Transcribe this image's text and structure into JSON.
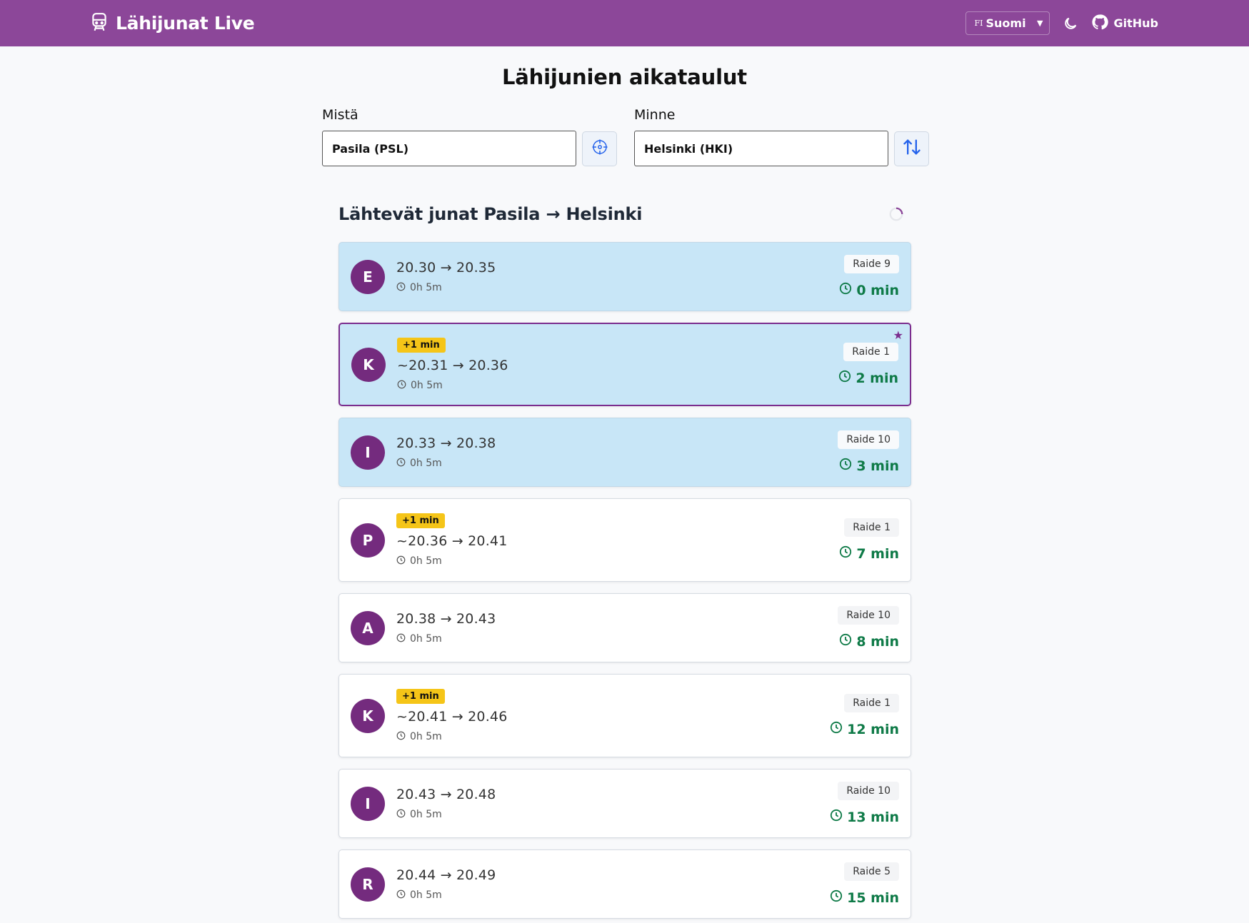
{
  "header": {
    "title": "Lähijunat Live",
    "lang_code": "FI",
    "lang_name": "Suomi",
    "github_label": "GitHub",
    "colors": {
      "bar": "#8c4799",
      "accent": "#742b7e"
    }
  },
  "page": {
    "title": "Lähijunien aikataulut"
  },
  "form": {
    "from": {
      "label": "Mistä",
      "value": "Pasila (PSL)"
    },
    "to": {
      "label": "Minne",
      "value": "Helsinki (HKI)"
    },
    "locate_icon": "crosshair-icon",
    "swap_icon": "swap-arrows-icon"
  },
  "departures": {
    "title": "Lähtevät junat Pasila → Helsinki",
    "items": [
      {
        "line": "E",
        "times": "20.30 → 20.35",
        "duration": "0h 5m",
        "track": "Raide 9",
        "eta": "0 min"
      },
      {
        "line": "K",
        "delay": "+1 min",
        "times": "~20.31 → 20.36",
        "duration": "0h 5m",
        "track": "Raide 1",
        "eta": "2 min",
        "starred": true
      },
      {
        "line": "I",
        "times": "20.33 → 20.38",
        "duration": "0h 5m",
        "track": "Raide 10",
        "eta": "3 min"
      },
      {
        "line": "P",
        "delay": "+1 min",
        "times": "~20.36 → 20.41",
        "duration": "0h 5m",
        "track": "Raide 1",
        "eta": "7 min"
      },
      {
        "line": "A",
        "times": "20.38 → 20.43",
        "duration": "0h 5m",
        "track": "Raide 10",
        "eta": "8 min"
      },
      {
        "line": "K",
        "delay": "+1 min",
        "times": "~20.41 → 20.46",
        "duration": "0h 5m",
        "track": "Raide 1",
        "eta": "12 min"
      },
      {
        "line": "I",
        "times": "20.43 → 20.48",
        "duration": "0h 5m",
        "track": "Raide 10",
        "eta": "13 min"
      },
      {
        "line": "R",
        "times": "20.44 → 20.49",
        "duration": "0h 5m",
        "track": "Raide 5",
        "eta": "15 min"
      }
    ]
  }
}
